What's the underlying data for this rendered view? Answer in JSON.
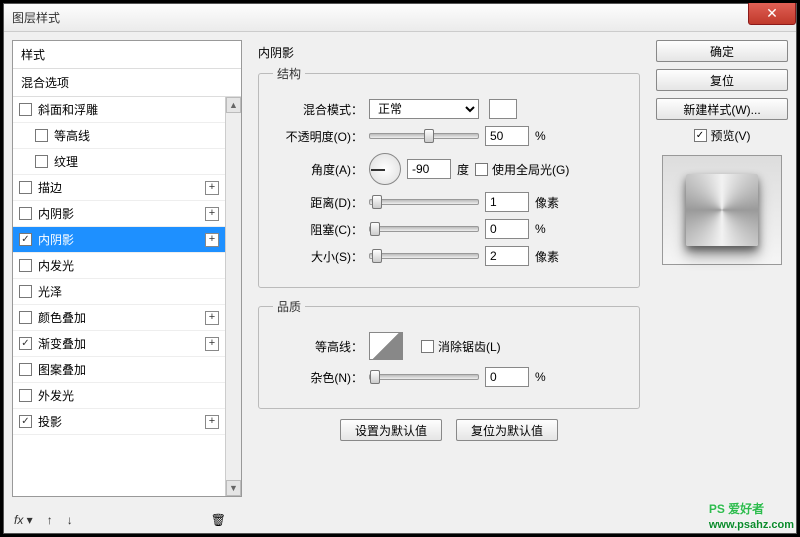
{
  "window": {
    "title": "图层样式"
  },
  "sidebar": {
    "header": "样式",
    "blending": "混合选项",
    "items": [
      {
        "label": "斜面和浮雕",
        "checked": false,
        "plus": false,
        "indent": false
      },
      {
        "label": "等高线",
        "checked": false,
        "plus": false,
        "indent": true
      },
      {
        "label": "纹理",
        "checked": false,
        "plus": false,
        "indent": true
      },
      {
        "label": "描边",
        "checked": false,
        "plus": true,
        "indent": false
      },
      {
        "label": "内阴影",
        "checked": false,
        "plus": true,
        "indent": false
      },
      {
        "label": "内阴影",
        "checked": true,
        "plus": true,
        "indent": false,
        "selected": true
      },
      {
        "label": "内发光",
        "checked": false,
        "plus": false,
        "indent": false
      },
      {
        "label": "光泽",
        "checked": false,
        "plus": false,
        "indent": false
      },
      {
        "label": "颜色叠加",
        "checked": false,
        "plus": true,
        "indent": false
      },
      {
        "label": "渐变叠加",
        "checked": true,
        "plus": true,
        "indent": false
      },
      {
        "label": "图案叠加",
        "checked": false,
        "plus": false,
        "indent": false
      },
      {
        "label": "外发光",
        "checked": false,
        "plus": false,
        "indent": false
      },
      {
        "label": "投影",
        "checked": true,
        "plus": true,
        "indent": false
      }
    ],
    "footer_fx": "fx"
  },
  "main": {
    "title": "内阴影",
    "structure": {
      "legend": "结构",
      "blend_mode_label": "混合模式：",
      "blend_mode_value": "正常",
      "opacity_label": "不透明度(O)：",
      "opacity_value": "50",
      "opacity_unit": "%",
      "angle_label": "角度(A)：",
      "angle_value": "-90",
      "angle_unit": "度",
      "global_light": "使用全局光(G)",
      "distance_label": "距离(D)：",
      "distance_value": "1",
      "distance_unit": "像素",
      "choke_label": "阻塞(C)：",
      "choke_value": "0",
      "choke_unit": "%",
      "size_label": "大小(S)：",
      "size_value": "2",
      "size_unit": "像素"
    },
    "quality": {
      "legend": "品质",
      "contour_label": "等高线：",
      "antialias": "消除锯齿(L)",
      "noise_label": "杂色(N)：",
      "noise_value": "0",
      "noise_unit": "%"
    },
    "defaults": {
      "set": "设置为默认值",
      "reset": "复位为默认值"
    }
  },
  "right": {
    "ok": "确定",
    "cancel": "复位",
    "new_style": "新建样式(W)...",
    "preview": "预览(V)"
  },
  "watermark": {
    "brand": "PS 爱好者",
    "url": "www.psahz.com"
  }
}
